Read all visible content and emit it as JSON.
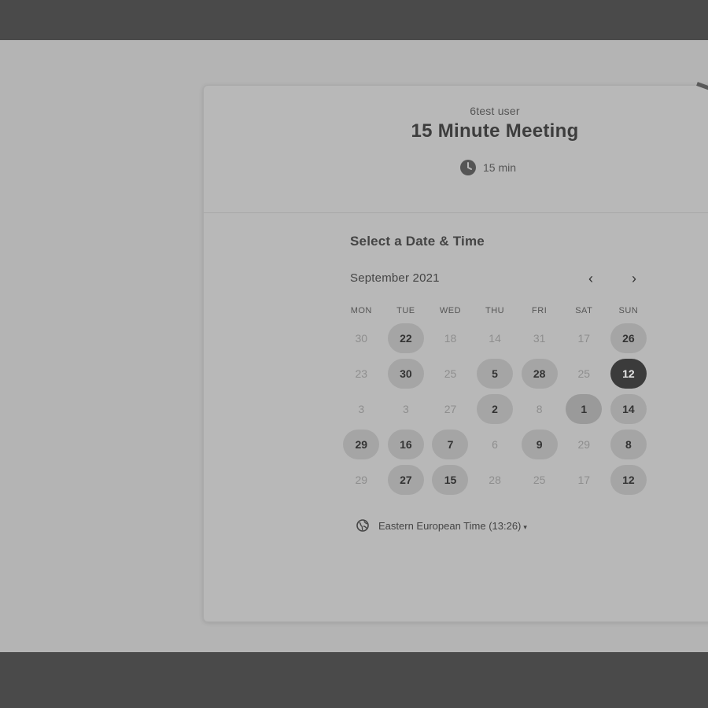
{
  "organizer_name": "6test user",
  "event_title": "15 Minute Meeting",
  "duration": {
    "icon": "clock-icon",
    "label": "15 min"
  },
  "picker": {
    "title": "Select a Date & Time",
    "month_label": "September 2021",
    "nav": {
      "prev": "‹",
      "next": "›"
    },
    "weekdays": [
      "MON",
      "TUE",
      "WED",
      "THU",
      "FRI",
      "SAT",
      "SUN"
    ],
    "weeks": [
      [
        {
          "label": "30",
          "state": "unavailable"
        },
        {
          "label": "22",
          "state": "available"
        },
        {
          "label": "18",
          "state": "unavailable"
        },
        {
          "label": "14",
          "state": "unavailable"
        },
        {
          "label": "31",
          "state": "unavailable"
        },
        {
          "label": "17",
          "state": "unavailable"
        },
        {
          "label": "26",
          "state": "available"
        }
      ],
      [
        {
          "label": "23",
          "state": "unavailable"
        },
        {
          "label": "30",
          "state": "available"
        },
        {
          "label": "25",
          "state": "unavailable"
        },
        {
          "label": "5",
          "state": "available"
        },
        {
          "label": "28",
          "state": "available"
        },
        {
          "label": "25",
          "state": "unavailable"
        },
        {
          "label": "12",
          "state": "selected"
        }
      ],
      [
        {
          "label": "3",
          "state": "unavailable"
        },
        {
          "label": "3",
          "state": "unavailable"
        },
        {
          "label": "27",
          "state": "unavailable"
        },
        {
          "label": "2",
          "state": "available"
        },
        {
          "label": "8",
          "state": "unavailable"
        },
        {
          "label": "1",
          "state": "today"
        },
        {
          "label": "14",
          "state": "available"
        }
      ],
      [
        {
          "label": "29",
          "state": "available"
        },
        {
          "label": "16",
          "state": "available"
        },
        {
          "label": "7",
          "state": "available"
        },
        {
          "label": "6",
          "state": "unavailable"
        },
        {
          "label": "9",
          "state": "available"
        },
        {
          "label": "29",
          "state": "unavailable"
        },
        {
          "label": "8",
          "state": "available"
        }
      ],
      [
        {
          "label": "29",
          "state": "unavailable"
        },
        {
          "label": "27",
          "state": "available"
        },
        {
          "label": "15",
          "state": "available"
        },
        {
          "label": "28",
          "state": "unavailable"
        },
        {
          "label": "25",
          "state": "unavailable"
        },
        {
          "label": "17",
          "state": "unavailable"
        },
        {
          "label": "12",
          "state": "available"
        }
      ]
    ]
  },
  "timezone": {
    "icon": "globe-icon",
    "label": "Eastern European Time (13:26)",
    "caret": "▾"
  },
  "colors": {
    "overlay": "#4a4a4a",
    "page": "#b4b4b4",
    "selected_day": "#3b3b3b",
    "available_day": "#a5a5a5"
  }
}
